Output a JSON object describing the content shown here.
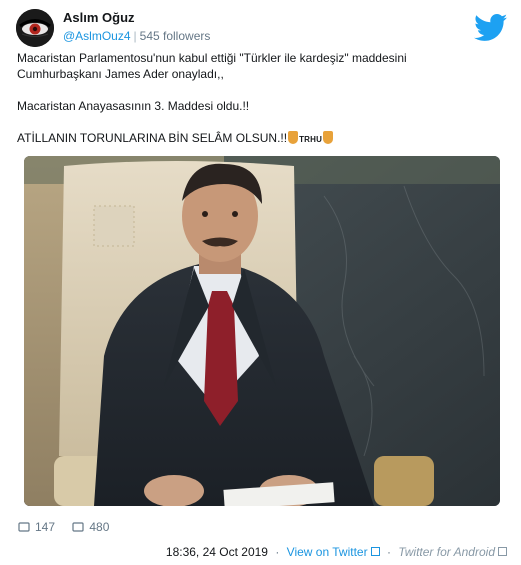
{
  "author": {
    "name": "Aslım Oğuz",
    "handle": "@AslmOuz4",
    "separator": "|",
    "followers": "545 followers"
  },
  "icons": {
    "brand": "twitter-bird-icon",
    "reply": "comment-icon",
    "like": "heart-icon",
    "external": "external-link-icon"
  },
  "tweet": {
    "line1": "Macaristan Parlamentosu'nun kabul ettiği \"Türkler ile kardeşiz\" maddesini",
    "line2": "Cumhurbaşkanı James Ader onayladı,,",
    "line3": "Macaristan Anayasasının 3. Maddesi oldu.!!",
    "line4": "ATİLLANIN TORUNLARINA BİN SELÂM OLSUN.!!",
    "emoji_tag": "TRHU"
  },
  "media": {
    "type": "photo"
  },
  "stats": {
    "replies": "147",
    "likes": "480"
  },
  "meta": {
    "timestamp": "18:36, 24 Oct 2019",
    "view_link": "View on Twitter",
    "bullet": "·",
    "source": "Twitter for Android"
  },
  "colors": {
    "brand": "#1da1f2",
    "link": "#1b95e0",
    "muted": "#657786"
  }
}
